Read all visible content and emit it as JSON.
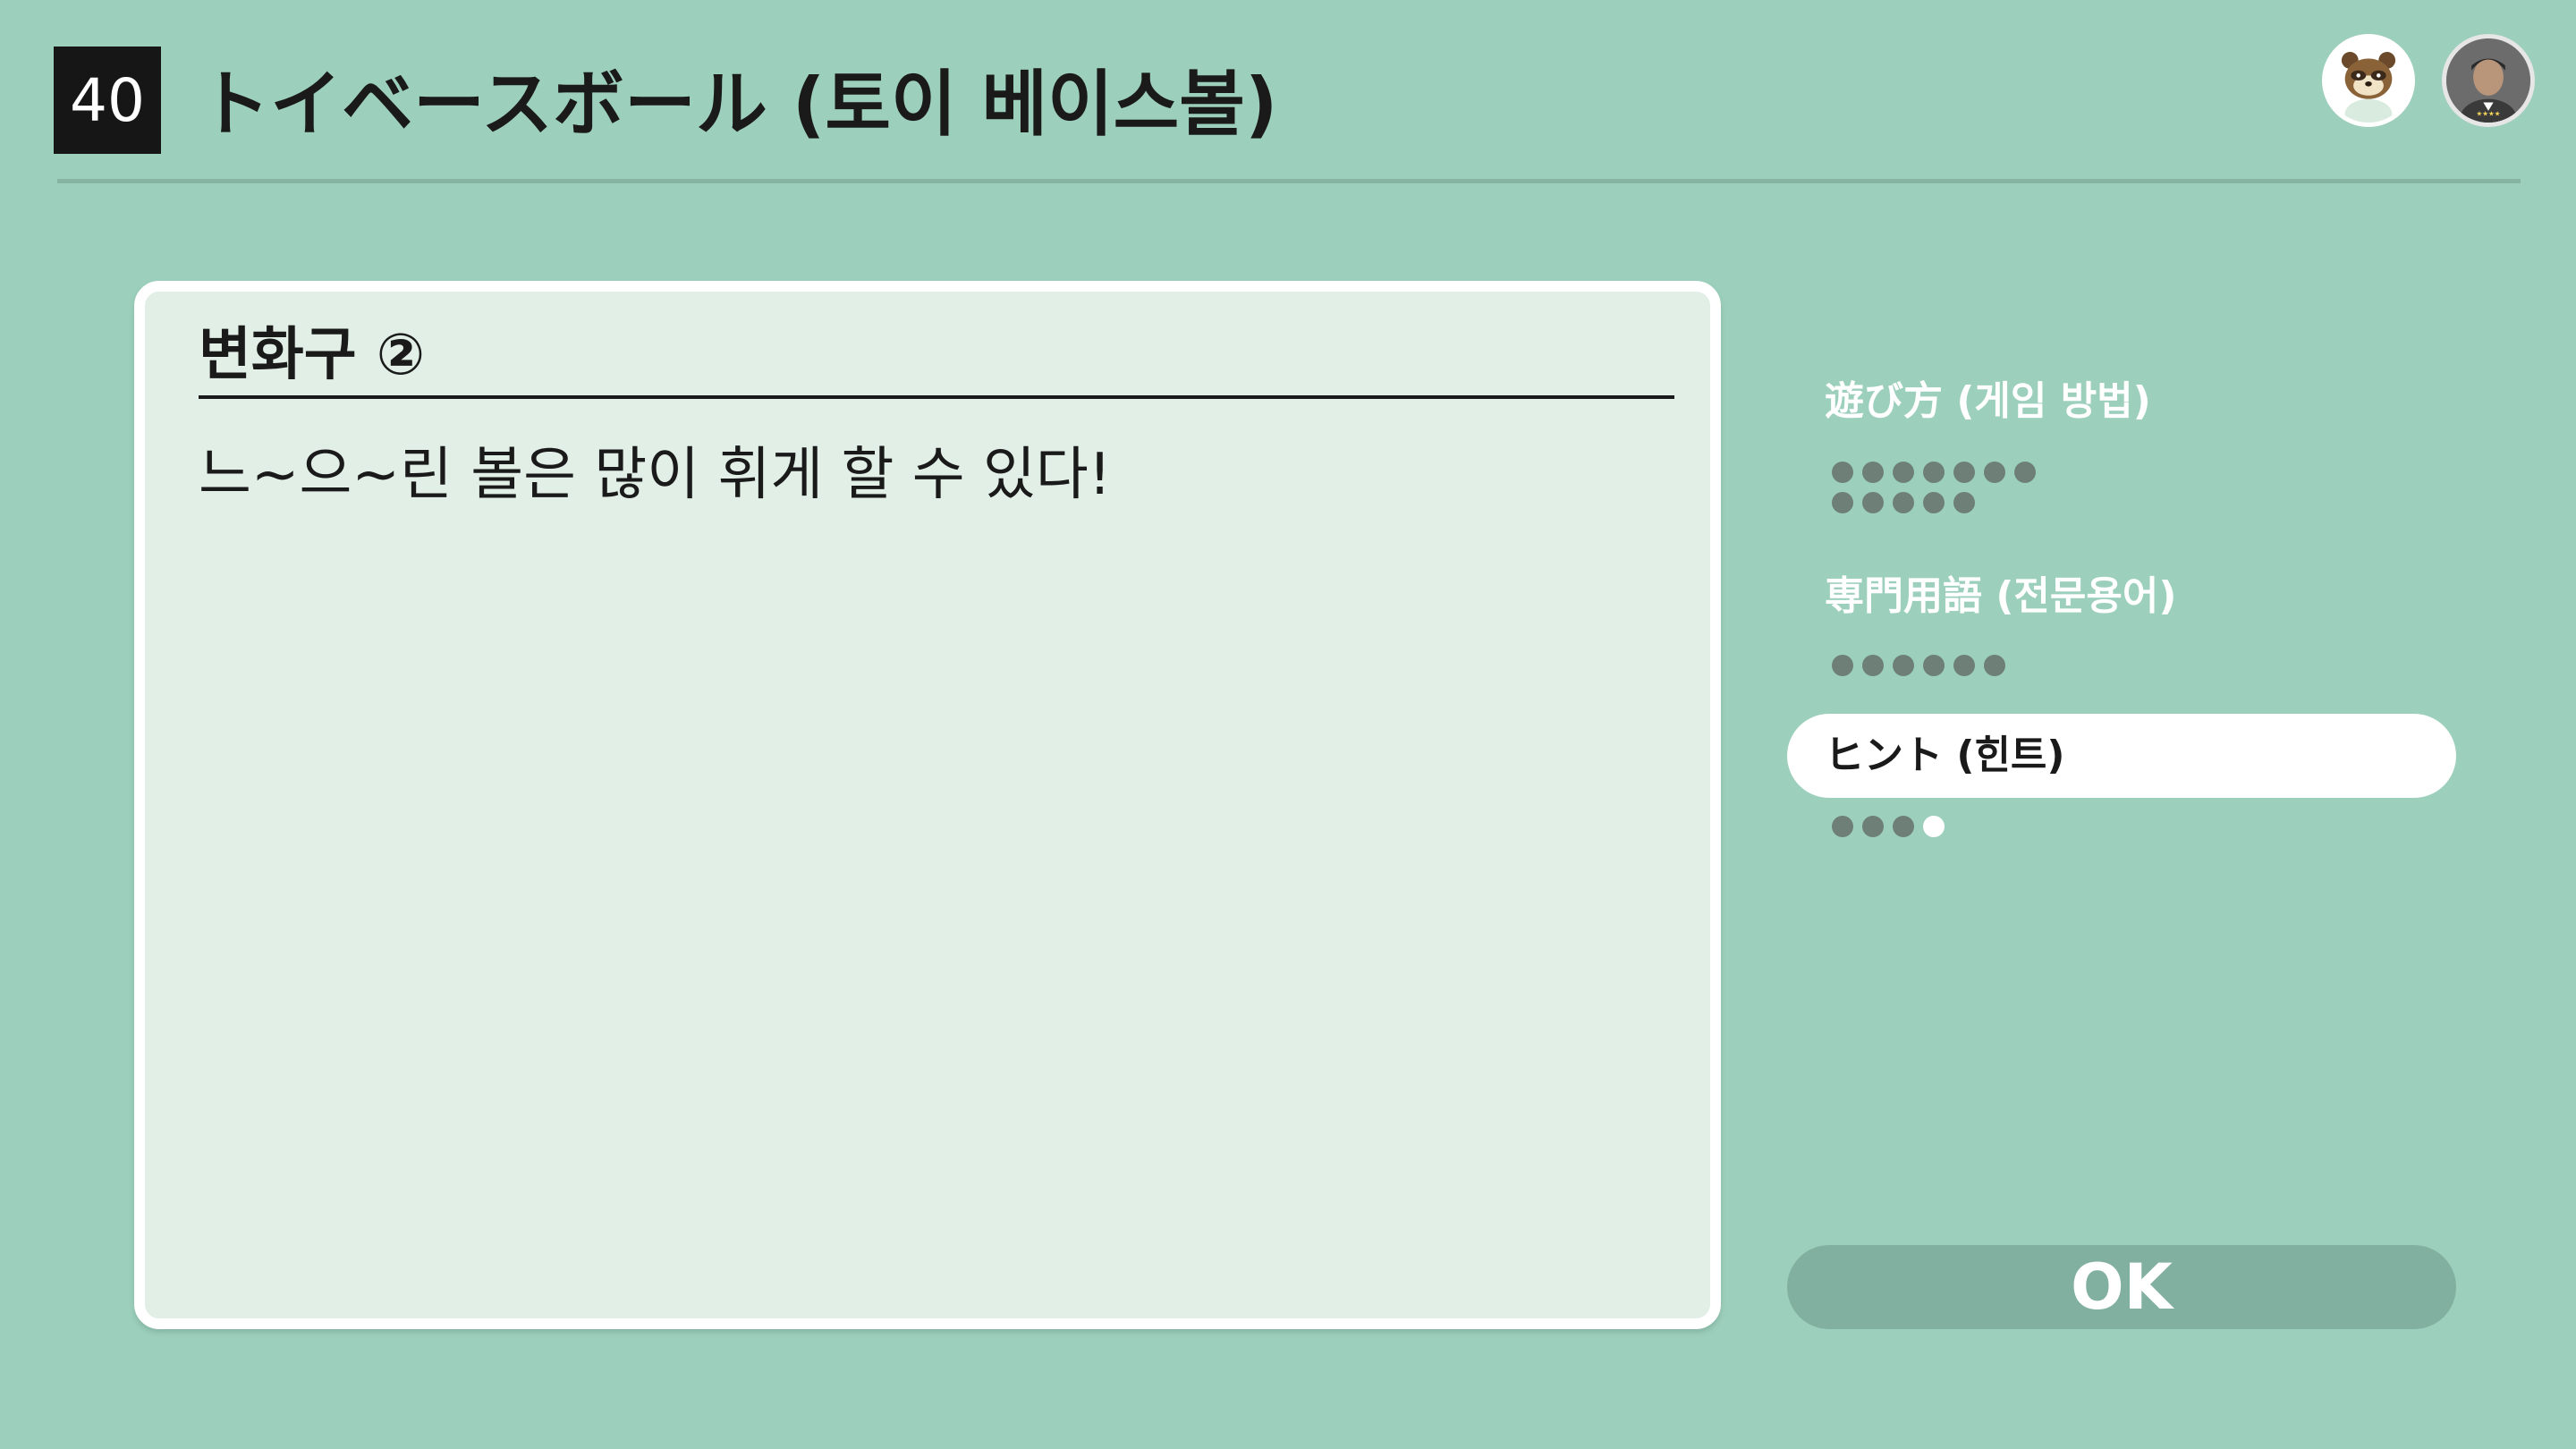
{
  "header": {
    "game_number": "40",
    "title": "トイベースボール (토이 베이스볼)"
  },
  "avatars": [
    {
      "name": "character-avatar"
    },
    {
      "name": "user-avatar"
    }
  ],
  "panel": {
    "title": "변화구 ②",
    "body": "느~으~린 볼은 많이 휘게 할 수 있다!"
  },
  "menu": {
    "items": [
      {
        "label": "遊び方 (게임 방법)",
        "page_count": 12,
        "current_page": null,
        "selected": false
      },
      {
        "label": "専門用語 (전문용어)",
        "page_count": 6,
        "current_page": null,
        "selected": false
      },
      {
        "label": "ヒント (힌트)",
        "page_count": 4,
        "current_page": 4,
        "selected": true
      }
    ]
  },
  "ok_button": {
    "label": "OK"
  },
  "colors": {
    "background": "#9dcfbd",
    "panel": "#e1efe6",
    "dot": "#6e7f78",
    "ok_button": "#82b0a0"
  }
}
